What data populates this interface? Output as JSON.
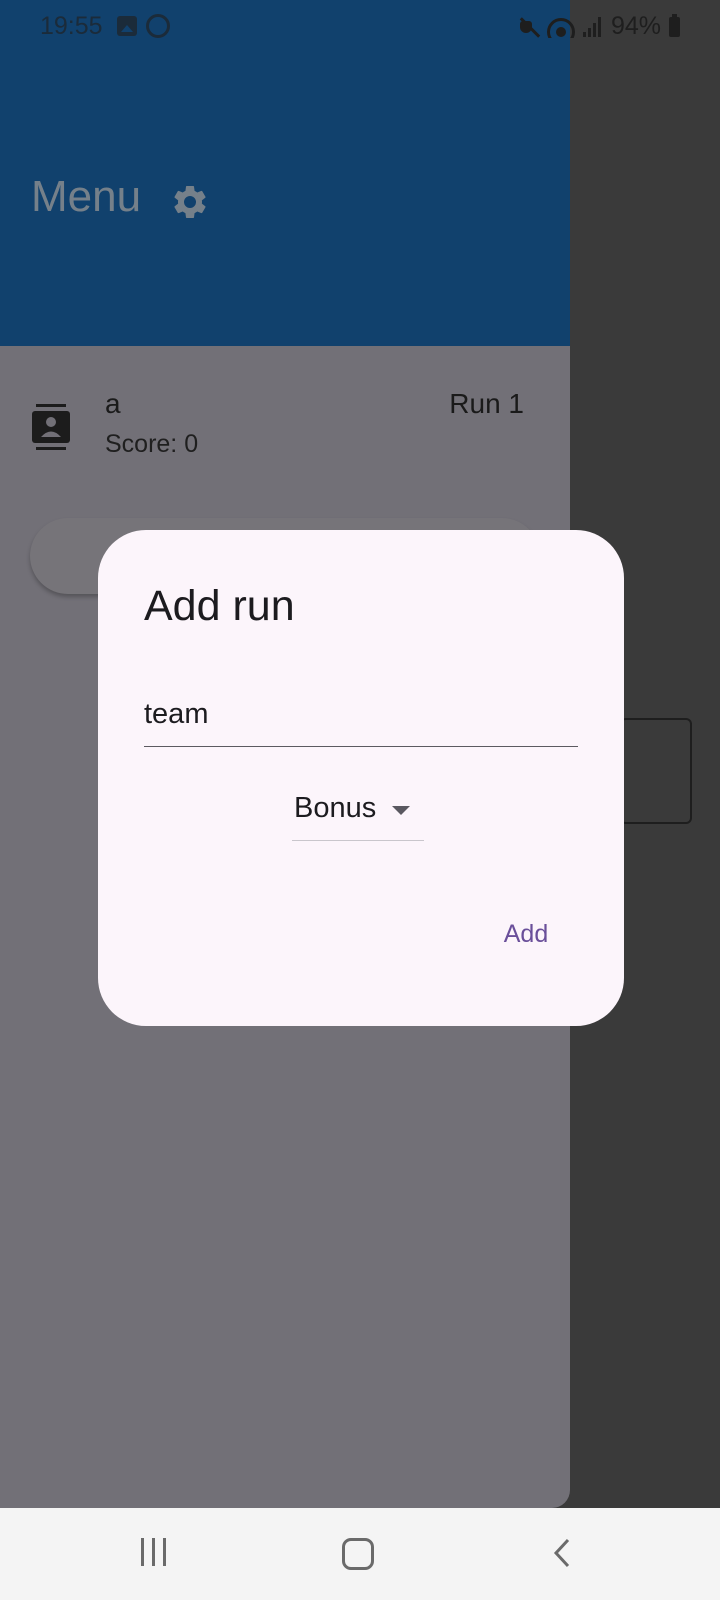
{
  "status_bar": {
    "time": "19:55",
    "battery": "94%",
    "icons": [
      "image-icon",
      "whatsapp-icon",
      "mute-icon",
      "wifi-icon",
      "signal-icon",
      "battery-icon"
    ]
  },
  "drawer": {
    "header_color": "#11416d",
    "title": "Menu",
    "settings_icon": "gear-icon",
    "list_item": {
      "name": "a",
      "score": "Score: 0",
      "run": "Run 1",
      "icon": "contact-card-icon"
    }
  },
  "dialog": {
    "title": "Add run",
    "team_input_value": "team",
    "dropdown_selected": "Bonus",
    "add_label": "Add",
    "accent_color": "#6a4f9a"
  },
  "nav_bar": {
    "recent": "recent-apps-icon",
    "home": "home-icon",
    "back": "back-icon"
  }
}
